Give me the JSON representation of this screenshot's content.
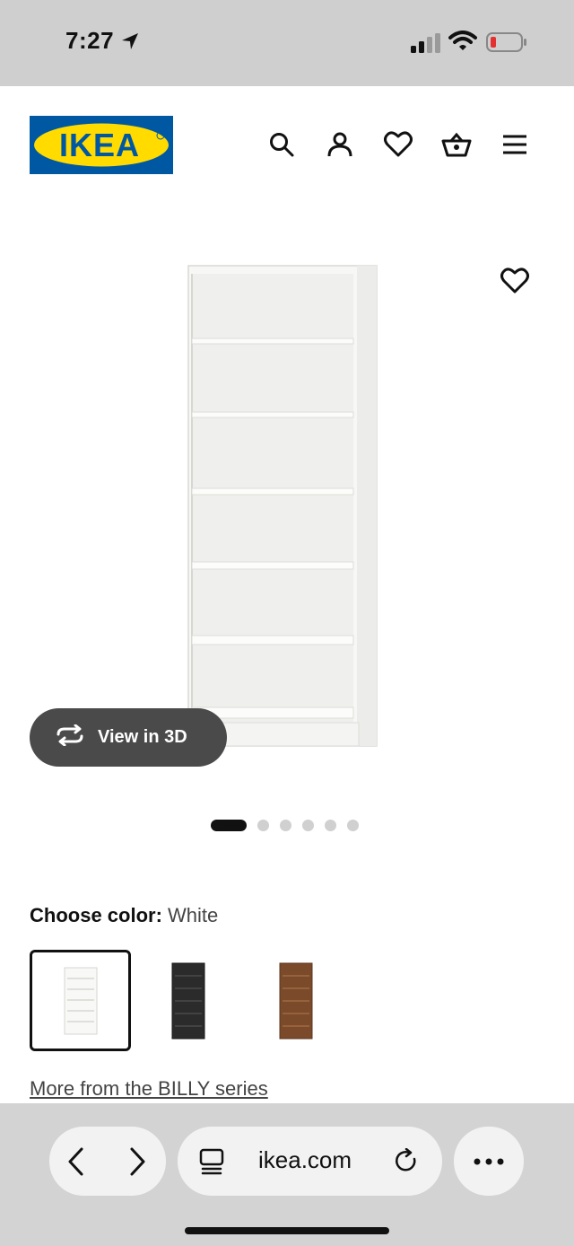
{
  "status_bar": {
    "time": "7:27"
  },
  "header": {
    "logo_text": "IKEA",
    "icons": [
      "search-icon",
      "user-icon",
      "heart-icon",
      "basket-icon",
      "menu-icon"
    ]
  },
  "product": {
    "view3d_label": "View in 3D",
    "image_count": 6,
    "active_image": 1
  },
  "color": {
    "label": "Choose color:",
    "value": "White",
    "swatches": [
      {
        "name": "White",
        "color": "#f3f3f1",
        "selected": true
      },
      {
        "name": "Black-brown",
        "color": "#2b2b2b",
        "selected": false
      },
      {
        "name": "Brown walnut",
        "color": "#7a4a2a",
        "selected": false
      }
    ]
  },
  "series_link": "More from the BILLY series",
  "browser": {
    "url": "ikea.com"
  },
  "colors": {
    "ikea_blue": "#0058a3",
    "ikea_yellow": "#ffdb00"
  }
}
